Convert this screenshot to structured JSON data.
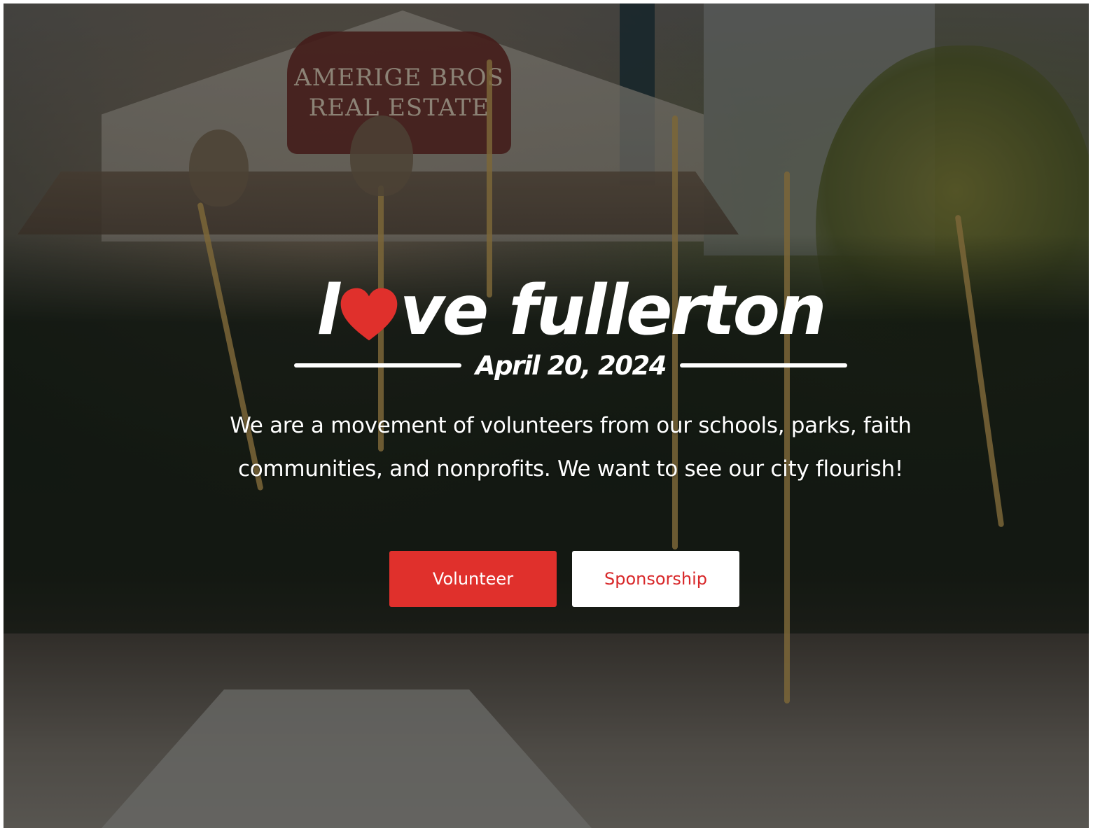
{
  "hero": {
    "sign_line1": "AMERIGE BROS",
    "sign_line2": "REAL ESTATE",
    "logo_l": "l",
    "logo_rest": "ve fullerton",
    "date": "April 20, 2024",
    "tagline_line1": "We are a movement of volunteers from our schools, parks, faith",
    "tagline_line2": "communities, and nonprofits. We want to see our city flourish!"
  },
  "buttons": {
    "volunteer_label": "Volunteer",
    "sponsorship_label": "Sponsorship"
  },
  "colors": {
    "heart": "#e0302c",
    "volunteer_bg": "#e0302c",
    "sponsorship_text": "#d8282a"
  },
  "icons": {
    "logo_o": "heart-icon"
  }
}
